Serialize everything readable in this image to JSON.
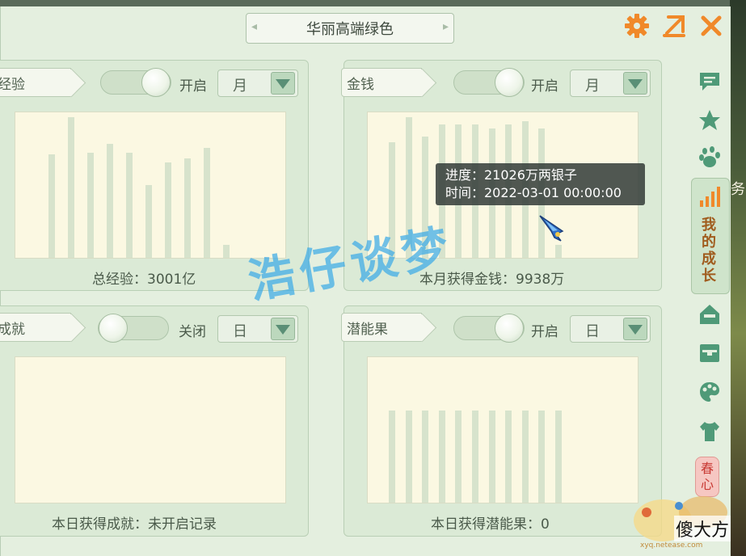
{
  "window": {
    "title": "华丽高端绿色"
  },
  "icons": {
    "settings": "gear-icon",
    "popout": "popout-arrow-icon",
    "close": "close-icon"
  },
  "panels": {
    "experience": {
      "tag": "经验",
      "toggle_label": "开启",
      "toggle_on": true,
      "period": "月",
      "footer": "总经验：3001亿",
      "bars": [
        0.73,
        0.99,
        0.74,
        0.8,
        0.74,
        0.51,
        0.67,
        0.7,
        0.77,
        0.09
      ]
    },
    "money": {
      "tag": "金钱",
      "toggle_label": "开启",
      "toggle_on": true,
      "period": "月",
      "footer": "本月获得金钱：9938万",
      "bars": [
        0.81,
        0.99,
        0.85,
        0.94,
        0.94,
        0.94,
        0.91,
        0.94,
        0.96,
        0.91,
        0.09
      ]
    },
    "achievement": {
      "tag": "成就",
      "toggle_label": "关闭",
      "toggle_on": false,
      "period": "日",
      "footer": "本日获得成就：未开启记录",
      "bars": []
    },
    "potential_fruit": {
      "tag": "潜能果",
      "toggle_label": "开启",
      "toggle_on": true,
      "period": "日",
      "footer": "本日获得潜能果：0",
      "bars": [
        0.65,
        0.65,
        0.65,
        0.65,
        0.65,
        0.65,
        0.65,
        0.65,
        0.65,
        0.65,
        0.65
      ]
    }
  },
  "tooltip": {
    "progress": "进度：21026万两银子",
    "time": "时间：2022-03-01 00:00:00"
  },
  "sidebar": {
    "items": [
      "chat-icon",
      "star-icon",
      "paw-icon",
      "signal-bars-icon",
      "home-icon",
      "chest-icon",
      "palette-icon",
      "shirt-icon"
    ],
    "active_label": "我的成长",
    "spring_label": "春心"
  },
  "watermark": "浩仔谈梦",
  "logo": {
    "text": "傻大方",
    "url": "xyq.netease.com"
  },
  "background_text": "务",
  "colors": {
    "accent_orange": "#f0892a",
    "chart_bg": "#fbf8e2",
    "bar": "#d7e3cc",
    "panel": "#dbead6"
  }
}
